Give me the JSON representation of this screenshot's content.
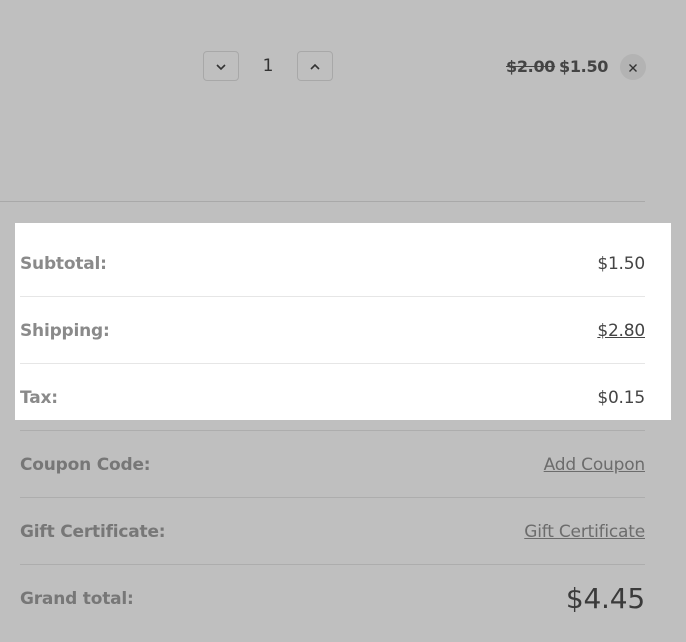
{
  "cart_item": {
    "quantity": "1",
    "original_price": "$2.00",
    "sale_price": "$1.50",
    "icons": {
      "decrease": "chevron-down-icon",
      "increase": "chevron-up-icon",
      "remove": "close-icon"
    }
  },
  "totals": {
    "subtotal": {
      "label": "Subtotal:",
      "value": "$1.50"
    },
    "shipping": {
      "label": "Shipping:",
      "value": "$2.80"
    },
    "tax": {
      "label": "Tax:",
      "value": "$0.15"
    },
    "coupon": {
      "label": "Coupon Code:",
      "value": "Add Coupon"
    },
    "gift_certificate": {
      "label": "Gift Certificate:",
      "value": "Gift Certificate"
    },
    "grand_total": {
      "label": "Grand total:",
      "value": "$4.45"
    }
  },
  "colors": {
    "overlay": "#bfbfbf",
    "highlight": "#ffffff",
    "text_dark": "#444444",
    "label_gray": "#8a8a8a"
  }
}
